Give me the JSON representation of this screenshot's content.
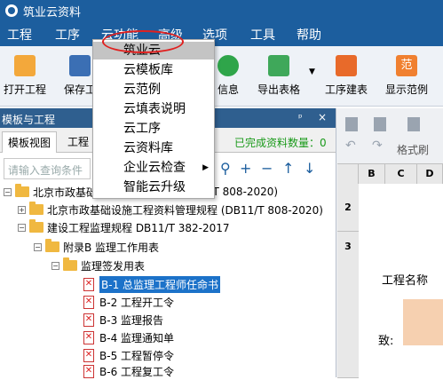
{
  "app": {
    "title": "筑业云资料"
  },
  "menu": [
    "工程",
    "工序",
    "云功能",
    "高级",
    "选项",
    "工具",
    "帮助"
  ],
  "toolbar": {
    "open": "打开工程",
    "save": "保存工",
    "info": "信息",
    "export": "导出表格",
    "process": "工序建表",
    "example": "显示范例"
  },
  "panel": {
    "title": "模板与工程",
    "pin": "ᵖ",
    "close": "×"
  },
  "tabs": {
    "template_view": "模板视图",
    "project": "工程"
  },
  "done_label": "已完成资料数量：0",
  "search": {
    "placeholder": "请输入查询条件"
  },
  "tree": [
    {
      "label": "北京市政基础",
      "suffix": "11-T 808-2020)",
      "level": 0
    },
    {
      "label": "北京市政基础设施工程资料管理规程 (DB11/T 808-2020)",
      "level": 1
    },
    {
      "label": "建设工程监理规程 DB11/T 382-2017",
      "level": 1
    },
    {
      "label": "附录B 监理工作用表",
      "level": 2
    },
    {
      "label": "监理签发用表",
      "level": 3
    },
    {
      "label": "B-1 总监理工程师任命书",
      "level": 4,
      "selected": true
    },
    {
      "label": "B-2 工程开工令",
      "level": 4
    },
    {
      "label": "B-3 监理报告",
      "level": 4
    },
    {
      "label": "B-4 监理通知单",
      "level": 4
    },
    {
      "label": "B-5 工程暂停令",
      "level": 4
    },
    {
      "label": "B-6 工程复工令",
      "level": 4
    }
  ],
  "cloud_menu": [
    "筑业云",
    "云模板库",
    "云范例",
    "云填表说明",
    "云工序",
    "云资料库",
    "企业云检查",
    "智能云升级"
  ],
  "right": {
    "format_brush": "格式刷",
    "cols": [
      "B",
      "C",
      "D"
    ],
    "rows": [
      "2",
      "3"
    ],
    "project_name": "工程名称",
    "to": "致:"
  },
  "colors": {
    "titlebar": "#1c5e9e",
    "selection": "#1c72c9",
    "highlight": "#e0201f",
    "done_green": "#1a9a1a"
  }
}
